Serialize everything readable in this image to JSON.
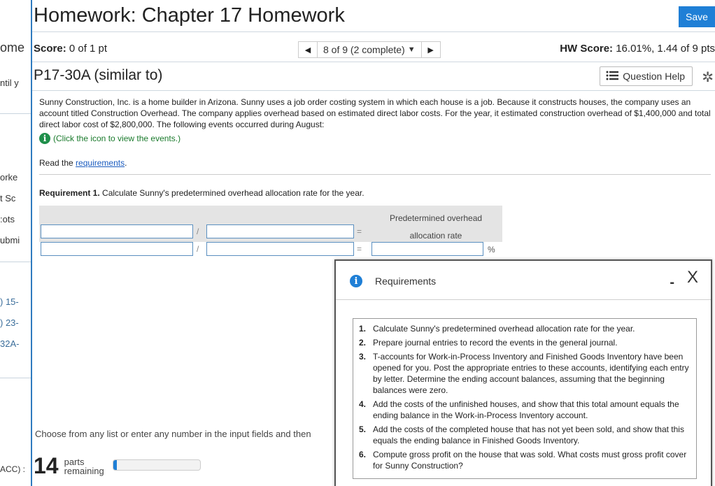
{
  "sidebar": {
    "ome": "ome",
    "until": "ntil y",
    "worked": "orke",
    "score": "t Sc",
    "points": "ots:",
    "submit": "ubmi",
    "item1": "-15 (",
    "item2": "-23 (",
    "item3": "-32A",
    "acc": ": (ACC"
  },
  "header": {
    "title": "Homework: Chapter 17 Homework",
    "save_label": "Save"
  },
  "scorebar": {
    "score_label": "Score:",
    "score_value": "0 of 1 pt",
    "nav_text": "8 of 9 (2 complete)",
    "hw_label": "HW Score:",
    "hw_value": "16.01%, 1.44 of 9 pts"
  },
  "problem": {
    "title": "P17-30A (similar to)",
    "help_label": "Question Help"
  },
  "content": {
    "paragraph": "Sunny Construction, Inc. is a home builder in Arizona. Sunny uses a job order costing system in which each house is a job. Because it constructs houses, the company uses an account titled Construction Overhead. The company applies overhead based on estimated direct labor costs. For the year, it estimated construction overhead of $1,400,000 and total direct labor cost of $2,800,000. The following events occurred during August:",
    "events_link": "(Click the icon to view the events.)",
    "read_prefix": "Read the ",
    "read_link": "requirements",
    "read_suffix": ".",
    "req1_label": "Requirement 1.",
    "req1_text": " Calculate Sunny's predetermined overhead allocation rate for the year.",
    "grid_header_line1": "Predetermined overhead",
    "grid_header_line2": "allocation rate",
    "divide_op": "/",
    "equals_op": "=",
    "percent": "%",
    "choose_text": "Choose from any list or enter any number in the input fields and then"
  },
  "footer": {
    "parts_count": "14",
    "parts_line1": "parts",
    "parts_line2": "remaining",
    "progress_fraction": 0.04
  },
  "popup": {
    "title": "Requirements",
    "minimize": "-",
    "close": "X",
    "items": [
      {
        "n": "1.",
        "text": "Calculate Sunny's predetermined overhead allocation rate for the year."
      },
      {
        "n": "2.",
        "text": "Prepare journal entries to record the events in the general journal."
      },
      {
        "n": "3.",
        "text": "T-accounts for Work-in-Process Inventory and Finished Goods Inventory have been opened for you. Post the appropriate entries to these accounts, identifying each entry by letter. Determine the ending account balances, assuming that the beginning balances were zero."
      },
      {
        "n": "4.",
        "text": "Add the costs of the unfinished houses, and show that this total amount equals the ending balance in the Work-in-Process Inventory account."
      },
      {
        "n": "5.",
        "text": "Add the costs of the completed house that has not yet been sold, and show that this equals the ending balance in Finished Goods Inventory."
      },
      {
        "n": "6.",
        "text": "Compute gross profit on the house that was sold. What costs must gross profit cover for Sunny Construction?"
      }
    ]
  }
}
